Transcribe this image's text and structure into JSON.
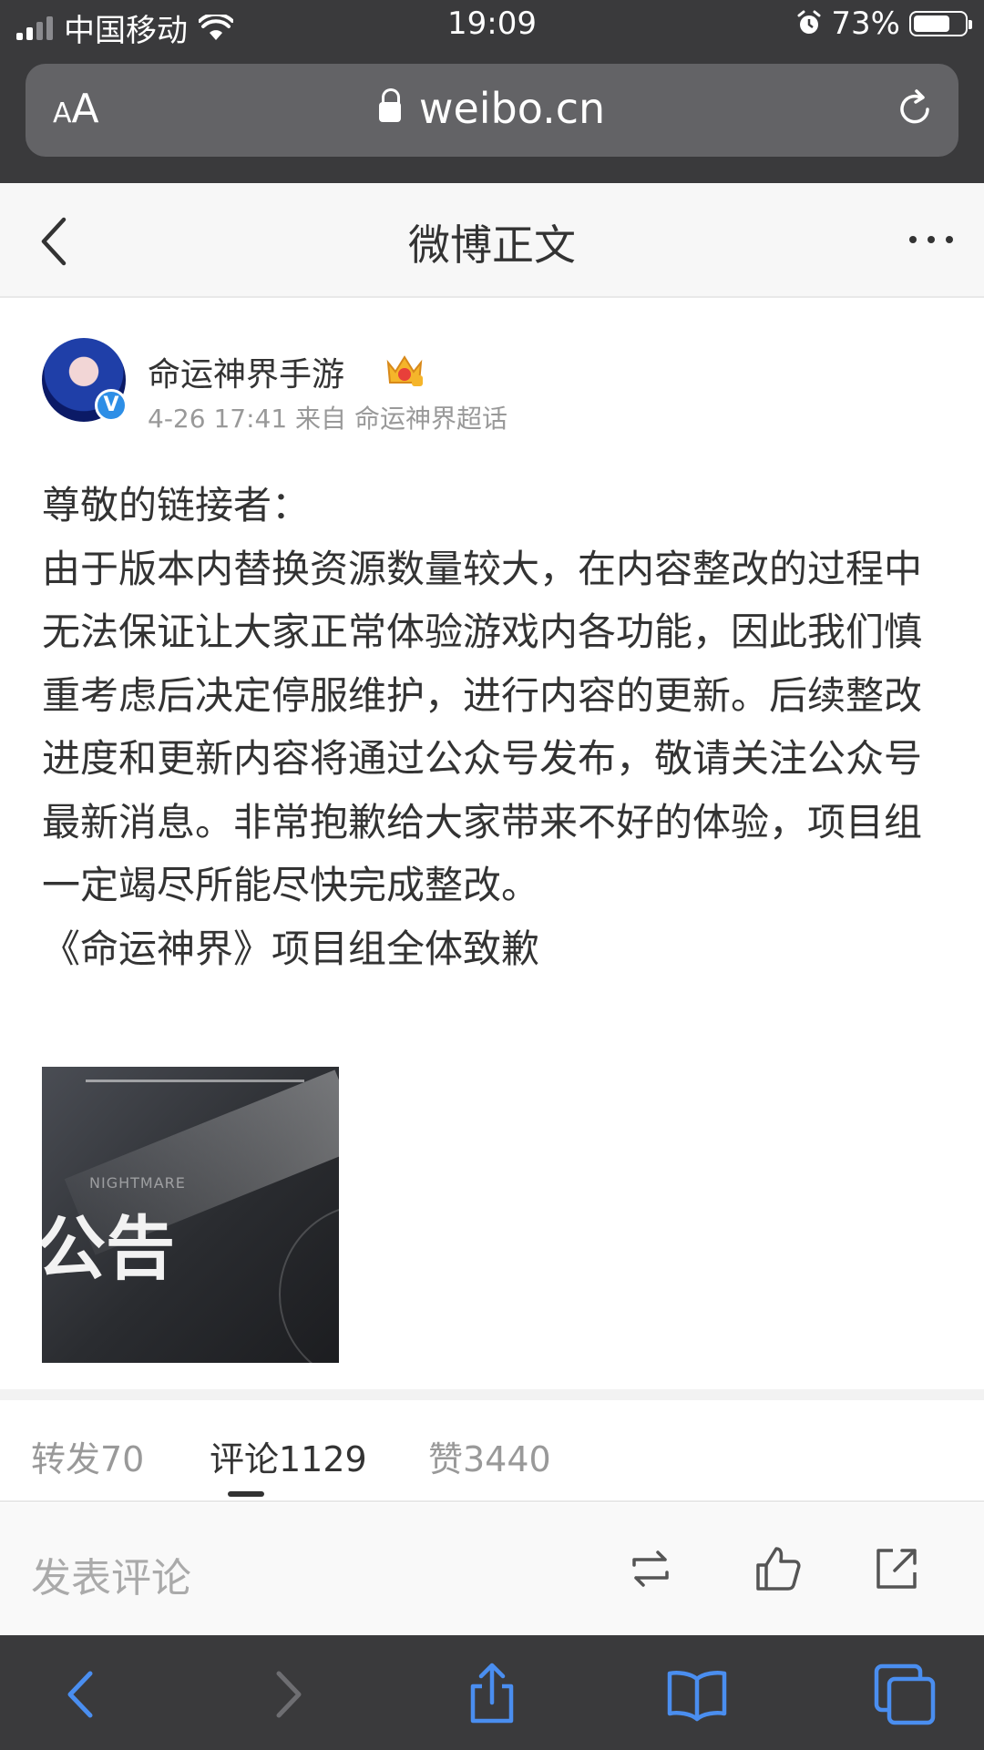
{
  "status_bar": {
    "carrier": "中国移动",
    "time": "19:09",
    "battery": "73%",
    "battery_level": 0.73
  },
  "browser": {
    "text_size_label": "AA",
    "url": "weibo.cn",
    "icons": [
      "lock-icon",
      "reload-icon"
    ]
  },
  "nav": {
    "title": "微博正文",
    "icons": [
      "back-chevron-icon",
      "more-icon"
    ]
  },
  "post": {
    "author": "命运神界手游",
    "meta": "4-26 17:41 来自 命运神界超话",
    "paragraphs": [
      "尊敬的链接者：",
      "由于版本内替换资源数量较大，在内容整改的过程中无法保证让大家正常体验游戏内各功能，因此我们慎重考虑后决定停服维护，进行内容的更新。后续整改进度和更新内容将通过公众号发布，敬请关注公众号最新消息。非常抱歉给大家带来不好的体验，项目组一定竭尽所能尽快完成整改。",
      "《命运神界》项目组全体致歉"
    ],
    "image": {
      "title": "公告",
      "subtitle": "NIGHTMARE"
    }
  },
  "tabs": [
    {
      "label": "转发70",
      "active": false
    },
    {
      "label": "评论1129",
      "active": true
    },
    {
      "label": "赞3440",
      "active": false
    }
  ],
  "actions": {
    "comment_placeholder": "发表评论",
    "icons": [
      "repost-icon",
      "like-icon",
      "share-icon"
    ]
  },
  "toolbar": {
    "icons": [
      "back-icon",
      "forward-icon",
      "share-icon",
      "bookmarks-icon",
      "tabs-icon"
    ]
  },
  "colors": {
    "browser_chrome": "#3a3a3c",
    "accent_blue": "#4a8ef0",
    "verified_badge": "#2d8ee6"
  }
}
